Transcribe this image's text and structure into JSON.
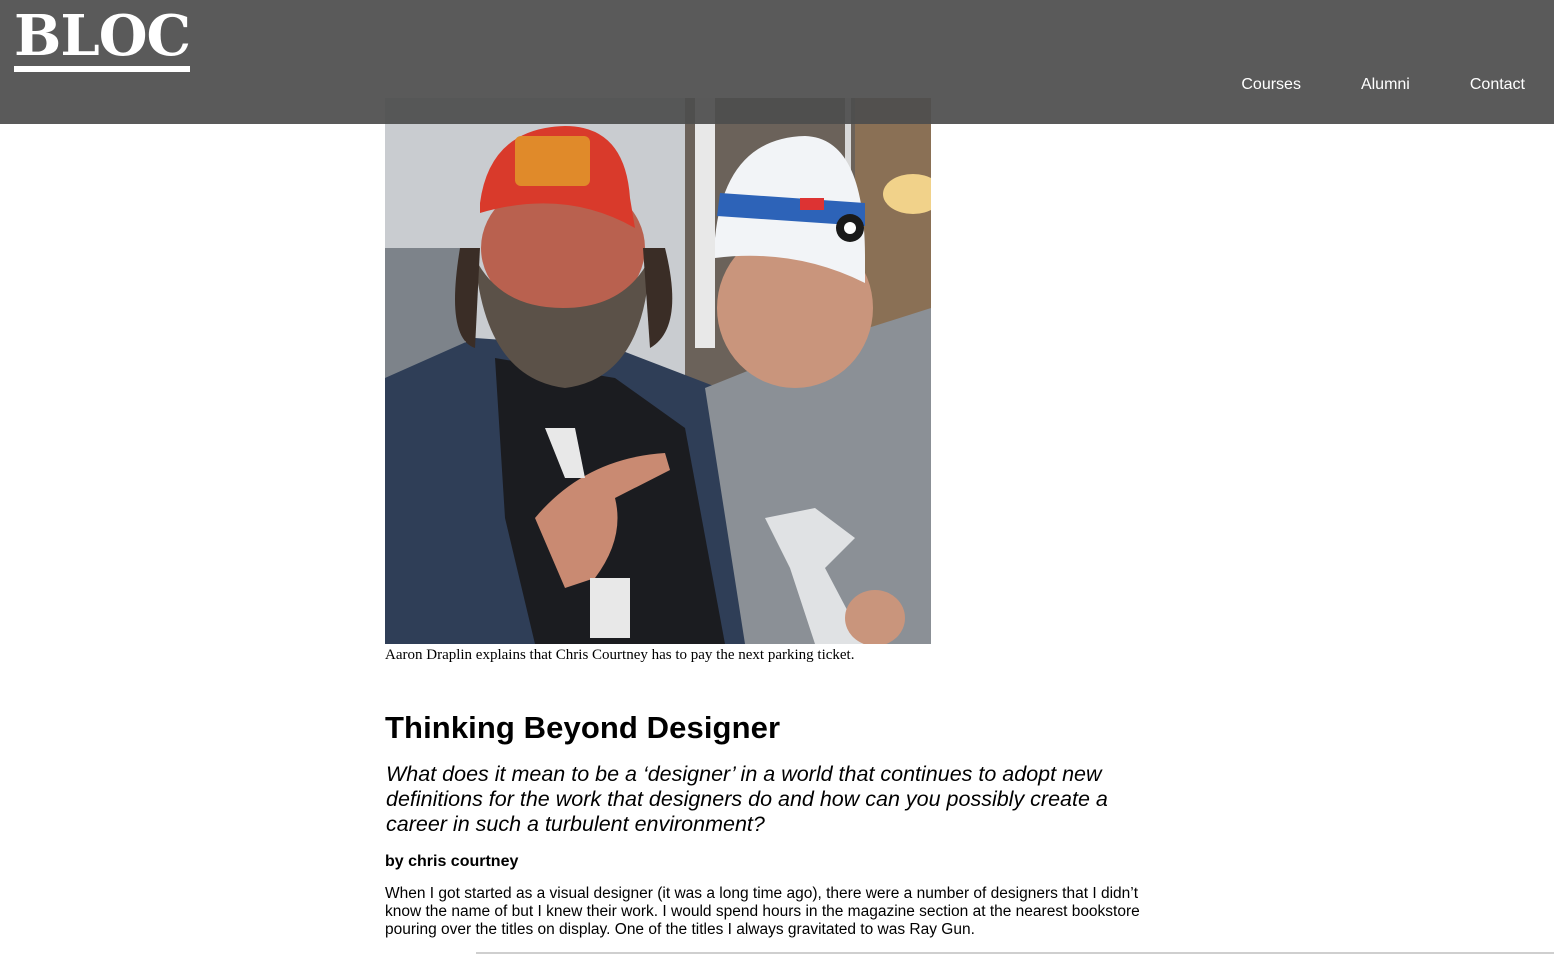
{
  "header": {
    "logo": "BLOC",
    "nav": [
      {
        "label": "Courses"
      },
      {
        "label": "Alumni"
      },
      {
        "label": "Contact"
      }
    ]
  },
  "photo": {
    "caption": "Aaron Draplin explains that Chris Courtney has to pay the next parking ticket."
  },
  "article": {
    "title": "Thinking Beyond Designer",
    "lede": "What does it mean to be a ‘designer’ in a world that continues to adopt new definitions for the work that designers do and how can you possibly create a career in such a turbulent environment?",
    "byline": "by chris courtney",
    "body": "When I got started as a visual designer (it was a long time ago), there were a number of designers that I didn’t know the name of but I knew their work. I would spend hours in the magazine section at the nearest bookstore pouring over the titles on display. One of the titles I always gravitated to was Ray Gun."
  },
  "colors": {
    "header_bg": "#4e4e4e",
    "header_text": "#ffffff",
    "page_bg": "#ffffff"
  }
}
